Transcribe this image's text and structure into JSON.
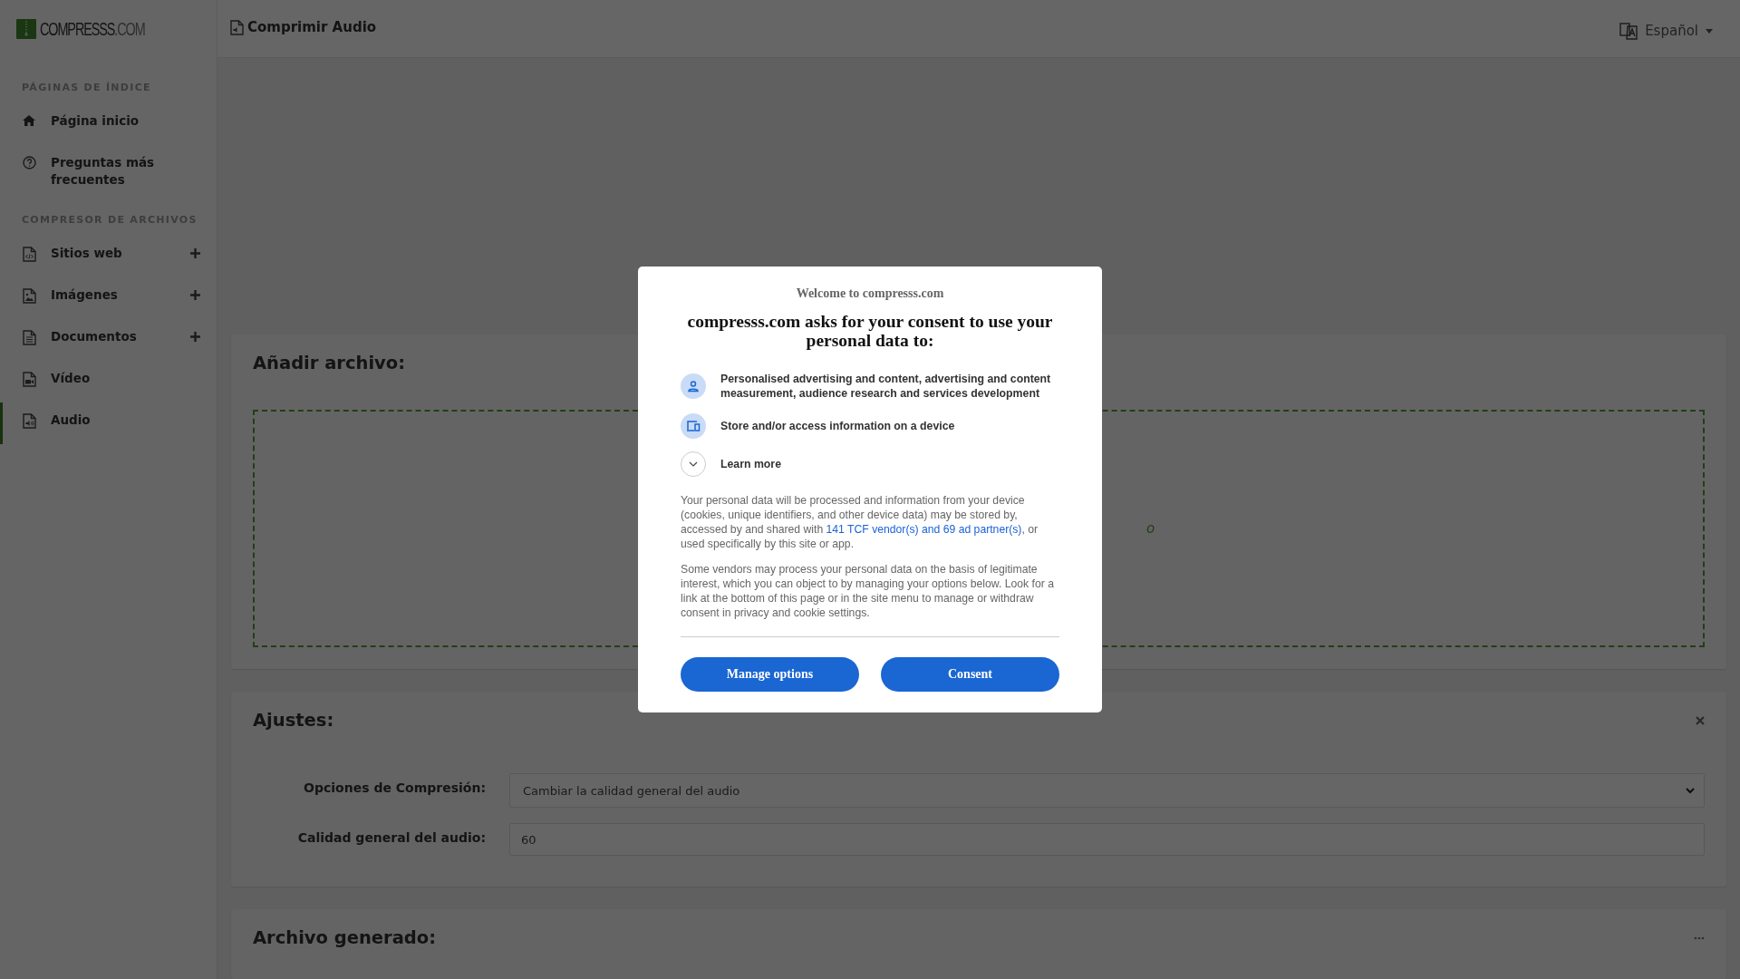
{
  "sidebar": {
    "logo": {
      "text": "COMPRESSS",
      "suffix": ".COM"
    },
    "sections": [
      {
        "heading": "PÁGINAS DE ÍNDICE",
        "items": [
          {
            "label": "Página inicio",
            "expandable": false,
            "selected": false
          },
          {
            "label": "Preguntas más frecuentes",
            "expandable": false,
            "selected": false
          }
        ]
      },
      {
        "heading": "COMPRESOR DE ARCHIVOS",
        "items": [
          {
            "label": "Sitios web",
            "expandable": true,
            "selected": false
          },
          {
            "label": "Imágenes",
            "expandable": true,
            "selected": false
          },
          {
            "label": "Documentos",
            "expandable": true,
            "selected": false
          },
          {
            "label": "Vídeo",
            "expandable": false,
            "selected": false
          },
          {
            "label": "Audio",
            "expandable": false,
            "selected": true
          }
        ]
      }
    ]
  },
  "header": {
    "title": "Comprimir Audio",
    "language": "Español"
  },
  "upload_card": {
    "title": "Añadir archivo:",
    "dropzone_text": "o"
  },
  "settings_card": {
    "title": "Ajustes:",
    "fields": [
      {
        "kind": "select",
        "label": "Opciones de Compresión:",
        "value": "Cambiar la calidad general del audio"
      },
      {
        "kind": "input",
        "label": "Calidad general del audio:",
        "value": "60"
      }
    ]
  },
  "output_card": {
    "title": "Archivo generado:"
  },
  "consent_dialog": {
    "welcome": "Welcome to compresss.com",
    "heading": "compresss.com asks for your consent to use your personal data to:",
    "purposes": [
      {
        "kind": "person",
        "text": "Personalised advertising and content, advertising and content measurement, audience research and services development"
      },
      {
        "kind": "device",
        "text": "Store and/or access information on a device"
      },
      {
        "kind": "expand",
        "text": "Learn more"
      }
    ],
    "paragraph_1_before": "Your personal data will be processed and information from your device (cookies, unique identifiers, and other device data) may be stored by, accessed by and shared with ",
    "paragraph_1_link": "141 TCF vendor(s) and 69 ad partner(s)",
    "paragraph_1_after": ", or used specifically by this site or app.",
    "paragraph_2": "Some vendors may process your personal data on the basis of legitimate interest, which you can object to by managing your options below. Look for a link at the bottom of this page or in the site menu to manage or withdraw consent in privacy and cookie settings.",
    "buttons": [
      "Manage options",
      "Consent"
    ]
  }
}
